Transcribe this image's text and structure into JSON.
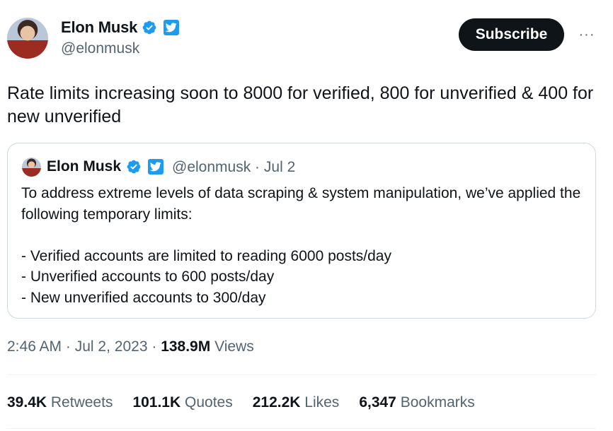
{
  "author": {
    "name": "Elon Musk",
    "handle": "@elonmusk"
  },
  "header": {
    "subscribe_label": "Subscribe",
    "more_label": "···"
  },
  "tweet": {
    "text": "Rate limits increasing soon to 8000 for verified, 800 for unverified & 400 for new unverified"
  },
  "quote": {
    "name": "Elon Musk",
    "handle": "@elonmusk",
    "separator": "·",
    "date": "Jul 2",
    "text": "To address extreme levels of data scraping & system manipulation, we’ve applied the following temporary limits:\n\n- Verified accounts are limited to reading 6000 posts/day\n- Unverified accounts to 600 posts/day\n- New unverified accounts to 300/day"
  },
  "meta": {
    "time": "2:46 AM",
    "separator": "·",
    "date": "Jul 2, 2023",
    "views_count": "138.9M",
    "views_label": "Views"
  },
  "stats": [
    {
      "value": "39.4K",
      "label": "Retweets"
    },
    {
      "value": "101.1K",
      "label": "Quotes"
    },
    {
      "value": "212.2K",
      "label": "Likes"
    },
    {
      "value": "6,347",
      "label": "Bookmarks"
    }
  ],
  "colors": {
    "verified": "#1d9bf0",
    "button_bg": "#0f1419",
    "secondary_text": "#536471",
    "border": "#cfd9de"
  },
  "icons": {
    "verified": "verified-badge-icon",
    "twitter": "twitter-bird-icon",
    "more": "more-dots-icon"
  }
}
